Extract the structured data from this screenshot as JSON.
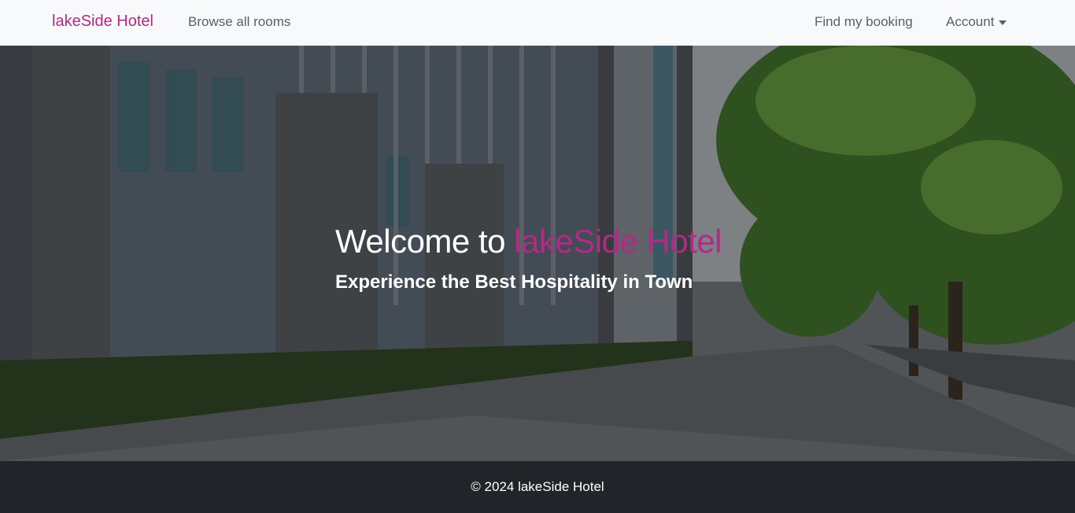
{
  "navbar": {
    "brand": "lakeSide Hotel",
    "browse_rooms": "Browse all rooms",
    "find_booking": "Find my booking",
    "account": "Account"
  },
  "hero": {
    "title_prefix": "Welcome to",
    "title_accent": "lakeSide Hotel",
    "subtitle": "Experience the Best Hospitality in Town"
  },
  "footer": {
    "text": "© 2024 lakeSide Hotel"
  },
  "colors": {
    "brand": "#b02a86",
    "navbar_bg": "#f8f9fa",
    "footer_bg": "#212529"
  }
}
